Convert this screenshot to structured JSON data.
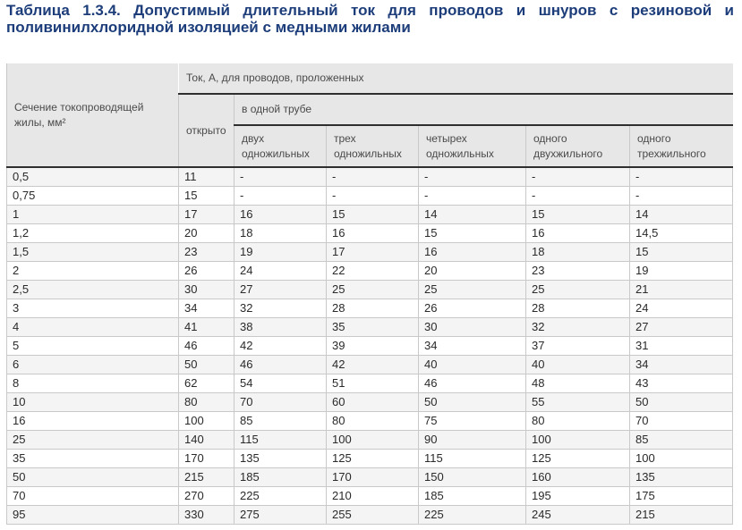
{
  "title": "Таблица 1.3.4. Допустимый длительный ток для проводов и шнуров с резиновой и поливинилхлоридной изоляцией с медными жилами",
  "table": {
    "section_header": "Сечение токопроводящей жилы, мм²",
    "current_header": "Ток, А, для проводов, проложенных",
    "open_header": "открыто",
    "tube_header": "в одной трубе",
    "tube_columns": [
      "двух одножильных",
      "трех одножильных",
      "четырех одножильных",
      "одного двухжильного",
      "одного трехжильного"
    ],
    "rows": [
      [
        "0,5",
        "11",
        "-",
        "-",
        "-",
        "-",
        "-"
      ],
      [
        "0,75",
        "15",
        "-",
        "-",
        "-",
        "-",
        "-"
      ],
      [
        "1",
        "17",
        "16",
        "15",
        "14",
        "15",
        "14"
      ],
      [
        "1,2",
        "20",
        "18",
        "16",
        "15",
        "16",
        "14,5"
      ],
      [
        "1,5",
        "23",
        "19",
        "17",
        "16",
        "18",
        "15"
      ],
      [
        "2",
        "26",
        "24",
        "22",
        "20",
        "23",
        "19"
      ],
      [
        "2,5",
        "30",
        "27",
        "25",
        "25",
        "25",
        "21"
      ],
      [
        "3",
        "34",
        "32",
        "28",
        "26",
        "28",
        "24"
      ],
      [
        "4",
        "41",
        "38",
        "35",
        "30",
        "32",
        "27"
      ],
      [
        "5",
        "46",
        "42",
        "39",
        "34",
        "37",
        "31"
      ],
      [
        "6",
        "50",
        "46",
        "42",
        "40",
        "40",
        "34"
      ],
      [
        "8",
        "62",
        "54",
        "51",
        "46",
        "48",
        "43"
      ],
      [
        "10",
        "80",
        "70",
        "60",
        "50",
        "55",
        "50"
      ],
      [
        "16",
        "100",
        "85",
        "80",
        "75",
        "80",
        "70"
      ],
      [
        "25",
        "140",
        "115",
        "100",
        "90",
        "100",
        "85"
      ],
      [
        "35",
        "170",
        "135",
        "125",
        "115",
        "125",
        "100"
      ],
      [
        "50",
        "215",
        "185",
        "170",
        "150",
        "160",
        "135"
      ],
      [
        "70",
        "270",
        "225",
        "210",
        "185",
        "195",
        "175"
      ],
      [
        "95",
        "330",
        "275",
        "255",
        "225",
        "245",
        "215"
      ]
    ]
  },
  "colors": {
    "title": "#1c3d7a",
    "header_bg": "#e7e7e7",
    "header_rule": "#2f2f2f",
    "row_alt": "#f4f4f4",
    "grid": "#c9c9c9"
  }
}
